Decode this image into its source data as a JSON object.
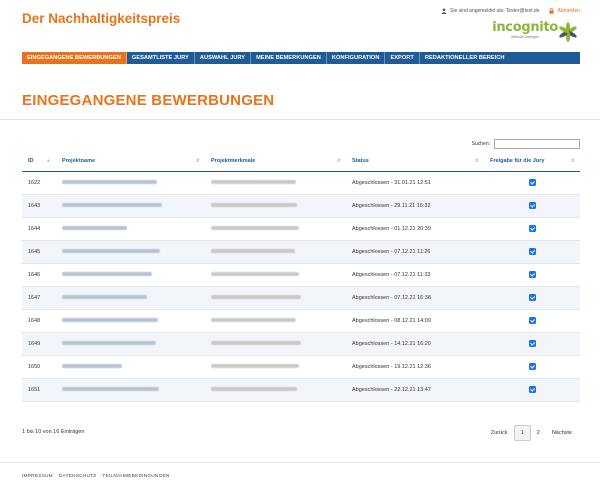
{
  "app": {
    "title": "Der Nachhaltigkeitspreis",
    "user_info": "Sie sind angemeldet als: Tester@test.de",
    "logout": "Abmelden",
    "logo_text": "incognito",
    "logo_sub": "Website Anzeigen"
  },
  "nav": {
    "items": [
      "EINGEGANGENE BEWERBUNGEN",
      "GESAMTLISTE JURY",
      "AUSWAHL JURY",
      "MEINE BEMERKUNGEN",
      "KONFIGURATION",
      "EXPORT",
      "REDAKTIONELLER BEREICH"
    ]
  },
  "page": {
    "title": "EINGEGANGENE BEWERBUNGEN"
  },
  "search": {
    "label": "Suchen:",
    "value": "",
    "placeholder": ""
  },
  "table": {
    "headers": [
      "ID",
      "Projektname",
      "Projektmerkmale",
      "Status",
      "Freigabe für die Jury"
    ],
    "rows": [
      {
        "id": "1622",
        "name": "",
        "features": "",
        "status": "Abgeschlossen - 31.01.21 12:51",
        "released": true
      },
      {
        "id": "1643",
        "name": "",
        "features": "",
        "status": "Abgeschlossen - 29.11.21 16:32",
        "released": true
      },
      {
        "id": "1644",
        "name": "",
        "features": "",
        "status": "Abgeschlossen - 01.12.21 20:39",
        "released": true
      },
      {
        "id": "1645",
        "name": "",
        "features": "",
        "status": "Abgeschlossen - 07.12.21 11:26",
        "released": true
      },
      {
        "id": "1646",
        "name": "",
        "features": "",
        "status": "Abgeschlossen - 07.12.21 11:33",
        "released": true
      },
      {
        "id": "1647",
        "name": "",
        "features": "",
        "status": "Abgeschlossen - 07.12.21 16:38",
        "released": true
      },
      {
        "id": "1648",
        "name": "",
        "features": "",
        "status": "Abgeschlossen - 08.12.21 14:09",
        "released": true
      },
      {
        "id": "1649",
        "name": "",
        "features": "",
        "status": "Abgeschlossen - 14.12.21 16:20",
        "released": true
      },
      {
        "id": "1650",
        "name": "",
        "features": "",
        "status": "Abgeschlossen - 19.12.21 12:36",
        "released": true
      },
      {
        "id": "1651",
        "name": "",
        "features": "",
        "status": "Abgeschlossen - 22.12.21 13:47",
        "released": true
      }
    ]
  },
  "pagination": {
    "info": "1 bis 10 von 16 Einträgen",
    "prev": "Zurück",
    "pages": [
      "1",
      "2"
    ],
    "current": "1",
    "next": "Nächste"
  },
  "footer": {
    "links": [
      "IMPRESSUM",
      "DATENSCHUTZ",
      "TEILNAHMEBEDINGUNGEN"
    ]
  },
  "colors": {
    "accent": "#e8731c",
    "nav": "#1f5b96",
    "logo": "#8bb63a",
    "checkbox": "#1a73e8"
  }
}
